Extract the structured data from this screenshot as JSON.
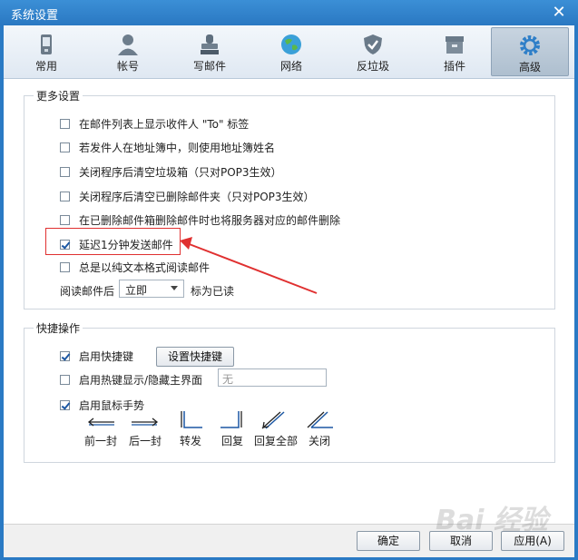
{
  "window": {
    "title": "系统设置"
  },
  "tabs": [
    {
      "label": "常用",
      "icon": "phone-icon"
    },
    {
      "label": "帐号",
      "icon": "user-icon"
    },
    {
      "label": "写邮件",
      "icon": "stamp-icon"
    },
    {
      "label": "网络",
      "icon": "globe-icon"
    },
    {
      "label": "反垃圾",
      "icon": "shield-icon"
    },
    {
      "label": "插件",
      "icon": "box-icon"
    },
    {
      "label": "高级",
      "icon": "gear-icon",
      "active": true
    }
  ],
  "more_settings": {
    "title": "更多设置",
    "options": [
      {
        "label": "在邮件列表上显示收件人 \"To\" 标签",
        "checked": false
      },
      {
        "label": "若发件人在地址簿中，则使用地址簿姓名",
        "checked": false
      },
      {
        "label": "关闭程序后清空垃圾箱（只对POP3生效）",
        "checked": false
      },
      {
        "label": "关闭程序后清空已删除邮件夹（只对POP3生效）",
        "checked": false
      },
      {
        "label": "在已删除邮件箱删除邮件时也将服务器对应的邮件删除",
        "checked": false
      },
      {
        "label": "延迟1分钟发送邮件",
        "checked": true
      },
      {
        "label": "总是以纯文本格式阅读邮件",
        "checked": false
      }
    ],
    "read_mark": {
      "prefix": "阅读邮件后",
      "selected": "立即",
      "suffix": "标为已读"
    }
  },
  "shortcuts": {
    "title": "快捷操作",
    "enable_hotkeys": {
      "label": "启用快捷键",
      "checked": true,
      "button": "设置快捷键"
    },
    "hotkey_toggle": {
      "label": "启用热键显示/隐藏主界面",
      "checked": false,
      "value": "无"
    },
    "mouse_gestures": {
      "label": "启用鼠标手势",
      "checked": true
    },
    "gestures": [
      "前一封",
      "后一封",
      "转发",
      "回复",
      "回复全部",
      "关闭"
    ]
  },
  "footer": {
    "ok": "确定",
    "cancel": "取消",
    "apply": "应用(A)"
  },
  "watermark": "Bai 经验",
  "colors": {
    "titlebar": "#2a78c2",
    "highlight": "#e03030",
    "arrow": "#e03030",
    "check": "#1b57a3"
  }
}
